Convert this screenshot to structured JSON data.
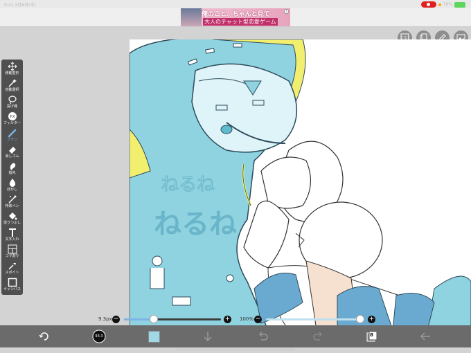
{
  "status_bar": {
    "left_text": "9:41 2月6日(木)",
    "right_text": "76%"
  },
  "ad": {
    "line1": "俺のこと、ちゃんと見て",
    "line2": "大人のチャット型恋愛ゲーム",
    "info": "i"
  },
  "top_tools": [
    "grid-icon",
    "layers-icon",
    "pen-edit-icon",
    "image-icon"
  ],
  "toolbar": {
    "tools": [
      {
        "label": "移動変形",
        "icon": "move-icon"
      },
      {
        "label": "自動選択",
        "icon": "magic-wand-icon"
      },
      {
        "label": "投げ縄",
        "icon": "lasso-icon"
      },
      {
        "label": "フィルター",
        "icon": "fx-icon"
      },
      {
        "label": "ブラシ",
        "icon": "brush-icon",
        "active": true
      },
      {
        "label": "消しゴム",
        "icon": "eraser-icon"
      },
      {
        "label": "指先",
        "icon": "finger-icon"
      },
      {
        "label": "ぼかし",
        "icon": "blur-drop-icon"
      },
      {
        "label": "特殊ペン",
        "icon": "special-pen-icon"
      },
      {
        "label": "塗りつぶし",
        "icon": "fill-bucket-icon"
      },
      {
        "label": "文字入れ",
        "icon": "text-icon"
      },
      {
        "label": "コマ割り",
        "icon": "frame-divide-icon"
      },
      {
        "label": "スポイト",
        "icon": "eyedropper-icon"
      },
      {
        "label": "キャンバス",
        "icon": "canvas-icon"
      }
    ]
  },
  "brush_size": {
    "label": "9.3px",
    "fraction": 0.31,
    "minus": "−",
    "plus": "+"
  },
  "opacity": {
    "label": "100%",
    "fraction": 1.0,
    "minus": "−",
    "plus": "+"
  },
  "bottom_bar": {
    "color_swatch": "#9fd9e6",
    "brush_preview_label": "93.3",
    "layer_count": "8"
  },
  "colors": {
    "accent": "#7fb3e6",
    "toolbar_bg": "#4f4f4f",
    "bottom_bg": "#6b6b6b",
    "canvas_bg": "#ffffff"
  },
  "canvas": {
    "watermark_top": "ねるね",
    "watermark_bottom": "ねるね"
  }
}
